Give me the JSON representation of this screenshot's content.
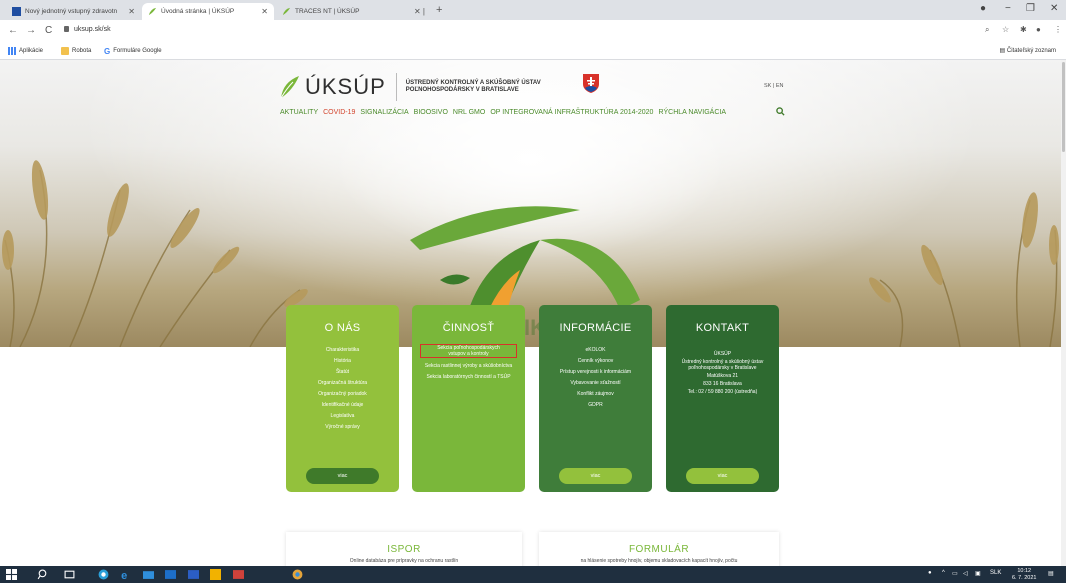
{
  "browser": {
    "tabs": [
      {
        "label": "Nový jednotný vstupný zdravotn",
        "active": false
      },
      {
        "label": "Úvodná stránka | ÚKSÚP",
        "active": true
      },
      {
        "label": "TRACES NT | ÚKSÚP",
        "active": false
      }
    ],
    "url": "uksup.sk/sk",
    "bookmarks": [
      "Aplikácie",
      "Robota",
      "Formuláre Google"
    ],
    "reading_list": "Čitateľský zoznam"
  },
  "header": {
    "logo_text": "ÚKSÚP",
    "institute_line1": "ÚSTREDNÝ KONTROLNÝ A SKÚŠOBNÝ ÚSTAV",
    "institute_line2": "POĽNOHOSPODÁRSKY V BRATISLAVE",
    "lang": "SK | EN"
  },
  "nav": [
    "AKTUALITY",
    "COVID-19",
    "SIGNALIZÁCIA",
    "BIOOSIVO",
    "NRL GMO",
    "OP INTEGROVANÁ INFRAŠTRUKTÚRA 2014-2020",
    "RÝCHLA NAVIGÁCIA"
  ],
  "hero": {
    "partial_text": "IK"
  },
  "cards": {
    "onas": {
      "title": "O NÁS",
      "items": [
        "Charakteristika",
        "História",
        "Štatút",
        "Organizačná štruktúra",
        "Organizačný poriadok",
        "Identifikačné údaje",
        "Legislatíva",
        "Výročné správy"
      ],
      "more": "viac"
    },
    "cinnost": {
      "title": "ČINNOSŤ",
      "items": [
        "Sekcia poľnohospodárskych vstupov a kontroly",
        "Sekcia rastlinnej výroby a skúšobníctva",
        "Sekcia laboratórnych činností a TSÚP"
      ],
      "more": ""
    },
    "informacie": {
      "title": "INFORMÁCIE",
      "items": [
        "eKOLOK",
        "Cenník výkonov",
        "Prístup verejnosti k informáciám",
        "Vybavovanie sťažností",
        "Konflikt záujmov",
        "GDPR"
      ],
      "more": "viac"
    },
    "kontakt": {
      "title": "KONTAKT",
      "lines": [
        "ÚKSÚP",
        "Ústredný kontrolný a skúšobný ústav poľnohospodársky v Bratislave",
        "Matúškova 21",
        "833 16 Bratislava",
        "Tel.: 02 / 59 880 200 (ústredňa)"
      ],
      "more": "viac"
    }
  },
  "bottom_boxes": {
    "ispor": {
      "title": "ISPOR",
      "text": "Online databáza pre prípravky na ochranu rastlín"
    },
    "formular": {
      "title": "FORMULÁR",
      "text": "na hlásenie spotreby hnojív, objemu skladovacích kapacít hnojív, počtu"
    }
  },
  "taskbar": {
    "lang": "SLK",
    "time": "10:12",
    "date": "6. 7. 2021"
  },
  "colors": {
    "accent_green": "#7ab73a",
    "dark_green": "#2e6a30",
    "covid_red": "#d2452e",
    "highlight_red": "#d8322a"
  }
}
